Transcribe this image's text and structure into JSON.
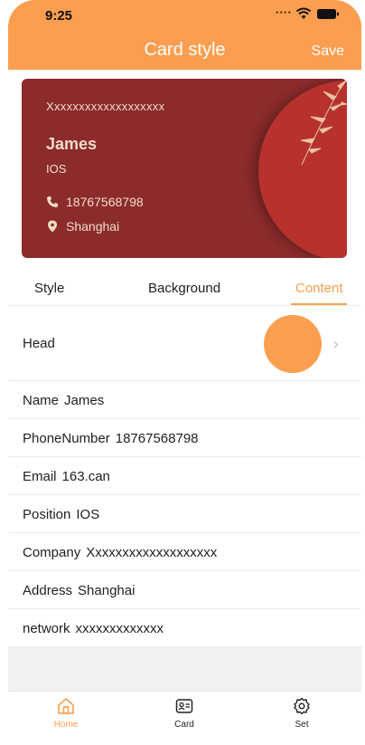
{
  "status_bar": {
    "time": "9:25"
  },
  "nav": {
    "title": "Card style",
    "save_label": "Save"
  },
  "card": {
    "company": "Xxxxxxxxxxxxxxxxxxx",
    "name": "James",
    "position": "IOS",
    "phone": "18767568798",
    "address": "Shanghai",
    "colors": {
      "background": "#8b2b2b",
      "circle": "#b7312d",
      "text": "#f2dcc6"
    }
  },
  "tabs": [
    {
      "label": "Style",
      "active": false
    },
    {
      "label": "Background",
      "active": false
    },
    {
      "label": "Content",
      "active": true
    }
  ],
  "head_row": {
    "label": "Head"
  },
  "fields": [
    {
      "label": "Name",
      "value": "James"
    },
    {
      "label": "PhoneNumber",
      "value": "18767568798"
    },
    {
      "label": "Email",
      "value": "163.can"
    },
    {
      "label": "Position",
      "value": "IOS"
    },
    {
      "label": "Company",
      "value": "Xxxxxxxxxxxxxxxxxxx"
    },
    {
      "label": "Address",
      "value": "Shanghai"
    },
    {
      "label": "network",
      "value": "xxxxxxxxxxxxx"
    }
  ],
  "tabbar": [
    {
      "label": "Home",
      "icon": "home-icon",
      "active": true
    },
    {
      "label": "Card",
      "icon": "card-icon",
      "active": false
    },
    {
      "label": "Set",
      "icon": "gear-icon",
      "active": false
    }
  ],
  "theme": {
    "accent": "#fc9e4f"
  }
}
